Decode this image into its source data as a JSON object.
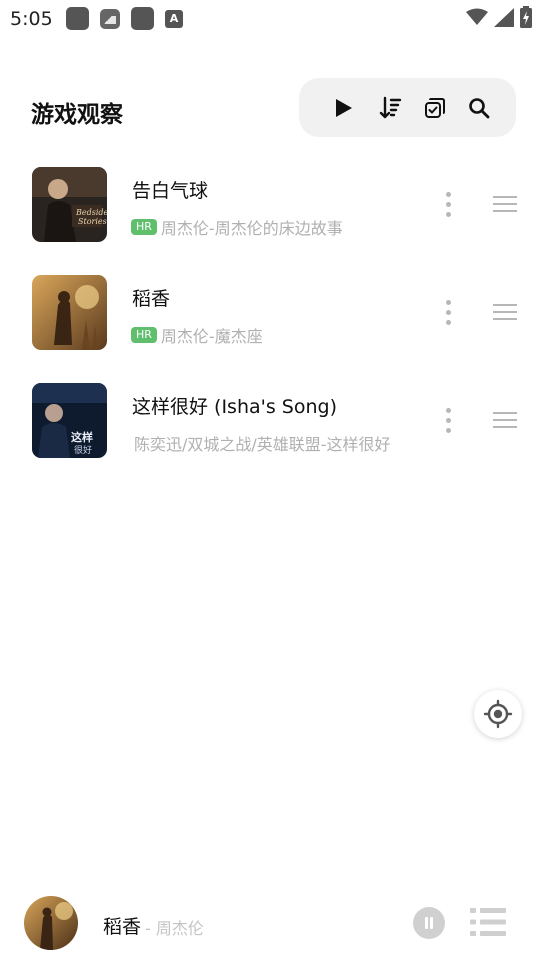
{
  "status_bar": {
    "time": "5:05"
  },
  "header": {
    "title": "游戏观察"
  },
  "songs": [
    {
      "title": "告白气球",
      "badge": "HR",
      "artist": "周杰伦-周杰伦的床边故事"
    },
    {
      "title": "稻香",
      "badge": "HR",
      "artist": "周杰伦-魔杰座"
    },
    {
      "title": "这样很好 (Isha's Song)",
      "badge": "",
      "artist": "陈奕迅/双城之战/英雄联盟-这样很好"
    }
  ],
  "player": {
    "title": "稻香",
    "artist": "- 周杰伦"
  },
  "colors": {
    "accent_badge": "#5fbf6c",
    "toolbar_bg": "#f1f1f1"
  }
}
